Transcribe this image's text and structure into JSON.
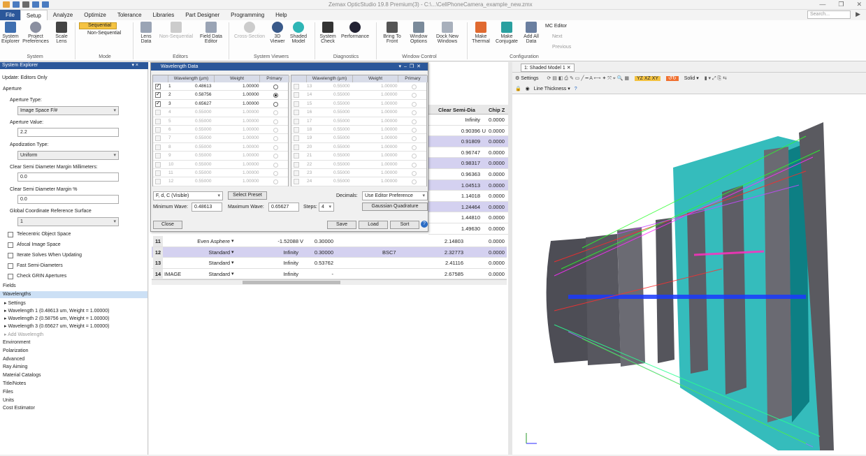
{
  "window": {
    "title": "Zemax OpticStudio 19.8 Premium(3) - C:\\...\\CellPhoneCamera_example_new.zmx",
    "search_placeholder": "Search..."
  },
  "menu": [
    "File",
    "Setup",
    "Analyze",
    "Optimize",
    "Tolerance",
    "Libraries",
    "Part Designer",
    "Programming",
    "Help"
  ],
  "ribbon": {
    "buttons": [
      {
        "label": "System\nExplorer",
        "icon": "system-explorer-icon"
      },
      {
        "label": "Project\nPreferences",
        "icon": "preferences-icon"
      },
      {
        "label": "Scale\nLens",
        "icon": "scale-icon"
      },
      {
        "label": "Lens\nData",
        "icon": "lens-data-icon"
      },
      {
        "label": "Non-Sequential",
        "icon": "nsc-editor-icon"
      },
      {
        "label": "Field Data\nEditor",
        "icon": "field-data-icon"
      },
      {
        "label": "Cross-Section",
        "icon": "cross-section-icon"
      },
      {
        "label": "3D\nViewer",
        "icon": "3d-viewer-icon"
      },
      {
        "label": "Shaded\nModel",
        "icon": "shaded-model-icon"
      },
      {
        "label": "System\nCheck",
        "icon": "system-check-icon"
      },
      {
        "label": "Performance",
        "icon": "performance-icon"
      },
      {
        "label": "Bring To\nFront",
        "icon": "bring-front-icon"
      },
      {
        "label": "Window\nOptions",
        "icon": "window-options-icon"
      },
      {
        "label": "Dock New\nWindows",
        "icon": "dock-icon"
      },
      {
        "label": "Make\nThermal",
        "icon": "thermal-icon"
      },
      {
        "label": "Make\nConjugate",
        "icon": "conjugate-icon"
      },
      {
        "label": "Add All\nData",
        "icon": "add-data-icon"
      }
    ],
    "mode_sequential": "Sequential",
    "mode_nonsequential": "Non-Sequential",
    "mc_editor": "MC Editor",
    "next": "Next",
    "previous": "Previous",
    "groups": [
      "System",
      "Mode",
      "Editors",
      "System Viewers",
      "Diagnostics",
      "Window Control",
      "Configuration"
    ]
  },
  "system_explorer": {
    "title": "System Explorer",
    "update": "Update: Editors Only",
    "aperture": "Aperture",
    "aperture_type_label": "Aperture Type:",
    "aperture_type_value": "Image Space F/#",
    "aperture_value_label": "Aperture Value:",
    "aperture_value": "2.2",
    "apodization_label": "Apodization Type:",
    "apodization_value": "Uniform",
    "csd_mm_label": "Clear Semi Diameter Margin Millimeters:",
    "csd_mm_value": "0.0",
    "csd_pct_label": "Clear Semi Diameter Margin %",
    "csd_pct_value": "0.0",
    "gcrs_label": "Global Coordinate Reference Surface",
    "gcrs_value": "1",
    "checks": [
      "Telecentric Object Space",
      "Afocal Image Space",
      "Iterate Solves When Updating",
      "Fast Semi-Diameters",
      "Check GRIN Apertures"
    ],
    "fields": "Fields",
    "wavelengths": "Wavelengths",
    "wl_items": [
      "Settings",
      "Wavelength 1 (0.48613 um, Weight = 1.00000)",
      "Wavelength 2 (0.58756 um, Weight = 1.00000)",
      "Wavelength 3 (0.65627 um, Weight = 1.00000)",
      "Add Wavelength"
    ],
    "sections": [
      "Environment",
      "Polarization",
      "Advanced",
      "Ray Aiming",
      "Material Catalogs",
      "Title/Notes",
      "Files",
      "Units",
      "Cost Estimator"
    ]
  },
  "wavelength_dialog": {
    "title": "Wavelength Data",
    "headers": [
      "Wavelength (µm)",
      "Weight",
      "Primary"
    ],
    "rows_left": [
      [
        "1",
        "0.48613",
        "1.00000"
      ],
      [
        "2",
        "0.58756",
        "1.00000"
      ],
      [
        "3",
        "0.65627",
        "1.00000"
      ],
      [
        "4",
        "0.55000",
        "1.00000"
      ],
      [
        "5",
        "0.55000",
        "1.00000"
      ],
      [
        "6",
        "0.55000",
        "1.00000"
      ],
      [
        "7",
        "0.55000",
        "1.00000"
      ],
      [
        "8",
        "0.55000",
        "1.00000"
      ],
      [
        "9",
        "0.55000",
        "1.00000"
      ],
      [
        "10",
        "0.55000",
        "1.00000"
      ],
      [
        "11",
        "0.55000",
        "1.00000"
      ],
      [
        "12",
        "0.55000",
        "1.00000"
      ]
    ],
    "rows_right": [
      [
        "13",
        "0.55000",
        "1.00000"
      ],
      [
        "14",
        "0.55000",
        "1.00000"
      ],
      [
        "15",
        "0.55000",
        "1.00000"
      ],
      [
        "16",
        "0.55000",
        "1.00000"
      ],
      [
        "17",
        "0.55000",
        "1.00000"
      ],
      [
        "18",
        "0.55000",
        "1.00000"
      ],
      [
        "19",
        "0.55000",
        "1.00000"
      ],
      [
        "20",
        "0.55000",
        "1.00000"
      ],
      [
        "21",
        "0.55000",
        "1.00000"
      ],
      [
        "22",
        "0.55000",
        "1.00000"
      ],
      [
        "23",
        "0.55000",
        "1.00000"
      ],
      [
        "24",
        "0.55000",
        "1.00000"
      ]
    ],
    "preset": "F, d, C (Visible)",
    "select_preset": "Select Preset",
    "decimals_label": "Decimals:",
    "decimals_value": "Use Editor Preference",
    "min_wave_label": "Minimum Wave:",
    "min_wave": "0.48613",
    "max_wave_label": "Maximum Wave:",
    "max_wave": "0.65627",
    "steps_label": "Steps:",
    "steps": "4",
    "gaussian": "Gaussian Quadrature",
    "close": "Close",
    "save": "Save",
    "load": "Load",
    "sort": "Sort"
  },
  "lens_data": {
    "col_csd": "Clear Semi-Dia",
    "col_chip": "Chip Z",
    "csd_values": [
      "Infinity",
      "0.90396",
      "0.91809",
      "0.96747",
      "0.98317",
      "0.96363",
      "1.04513",
      "1.14018",
      "1.24464",
      "1.44810",
      "1.49630"
    ],
    "csd_flags": [
      "",
      "U",
      "",
      "",
      "",
      "",
      "",
      "",
      "",
      "",
      ""
    ],
    "chip_values": [
      "0.0000",
      "0.0000",
      "0.0000",
      "0.0000",
      "0.0000",
      "0.0000",
      "0.0000",
      "0.0000",
      "0.0000",
      "0.0000",
      "0.0000"
    ],
    "rows": [
      {
        "num": "11",
        "comment": "",
        "type": "Even Asphere",
        "radius": "-1.52088",
        "solve": "V",
        "thick": "0.30000",
        "material": "",
        "csd": "2.14803",
        "chip": "0.0000"
      },
      {
        "num": "12",
        "comment": "",
        "type": "Standard",
        "radius": "Infinity",
        "solve": "",
        "thick": "0.30000",
        "material": "BSC7",
        "csd": "2.32773",
        "chip": "0.0000"
      },
      {
        "num": "13",
        "comment": "",
        "type": "Standard",
        "radius": "Infinity",
        "solve": "",
        "thick": "0.53762",
        "material": "",
        "csd": "2.41116",
        "chip": "0.0000"
      },
      {
        "num": "14",
        "comment": "IMAGE",
        "type": "Standard",
        "radius": "Infinity",
        "solve": "",
        "thick": "-",
        "material": "",
        "csd": "2.67585",
        "chip": "0.0000"
      }
    ]
  },
  "viewer": {
    "tab": "1: Shaded Model 1",
    "settings": "Settings",
    "solid": "Solid",
    "line_thickness": "Line Thickness"
  }
}
